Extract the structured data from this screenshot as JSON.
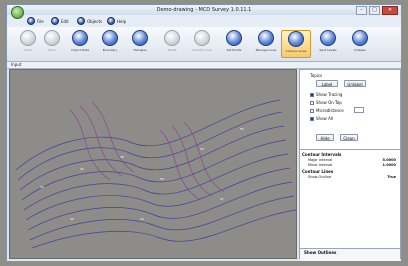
{
  "window": {
    "title": "Demo-drawing - MCD Survey 1.0.11.1"
  },
  "title_buttons": [
    "–",
    "□",
    "✕"
  ],
  "menu": [
    {
      "label": "File",
      "icon": "file-icon"
    },
    {
      "label": "Edit",
      "icon": "edit-icon"
    },
    {
      "label": "Objects",
      "icon": "objects-icon"
    },
    {
      "label": "Help",
      "icon": "help-icon"
    }
  ],
  "toolbar": [
    {
      "label": "Undo",
      "enabled": false
    },
    {
      "label": "Redo",
      "enabled": false
    },
    {
      "label": "Import Data",
      "enabled": true
    },
    {
      "label": "Boundary",
      "enabled": true
    },
    {
      "label": "Triangles",
      "enabled": true
    },
    {
      "label": "Break",
      "enabled": false
    },
    {
      "label": "Smooth Lines",
      "enabled": false
    },
    {
      "label": "Set Points",
      "enabled": true
    },
    {
      "label": "Manage Lines",
      "enabled": true
    },
    {
      "label": "Contour Lines",
      "enabled": true,
      "active": true
    },
    {
      "label": "Spot Levels",
      "enabled": true
    },
    {
      "label": "Indexes",
      "enabled": true
    }
  ],
  "tab": {
    "label": "Input"
  },
  "right_panel": {
    "group_label": "Topics",
    "buttons_top": [
      "Label",
      "Unlabel"
    ],
    "checks": [
      {
        "label": "Show Tracing",
        "checked": true
      },
      {
        "label": "Show On Top",
        "checked": false
      },
      {
        "label": "Microdistance",
        "checked": false
      },
      {
        "label": "Show All",
        "checked": true
      }
    ],
    "buttons_bottom": [
      "Hide",
      "Clean"
    ],
    "sections": [
      {
        "title": "Contour Intervals",
        "rows": [
          {
            "name": "Major Interval",
            "value": "5.0000"
          },
          {
            "name": "Minor Interval",
            "value": "1.0000"
          }
        ]
      },
      {
        "title": "Contour Lines",
        "rows": [
          {
            "name": "Show Outline",
            "value": "True"
          }
        ]
      }
    ],
    "description_title": "Show Outlines"
  }
}
